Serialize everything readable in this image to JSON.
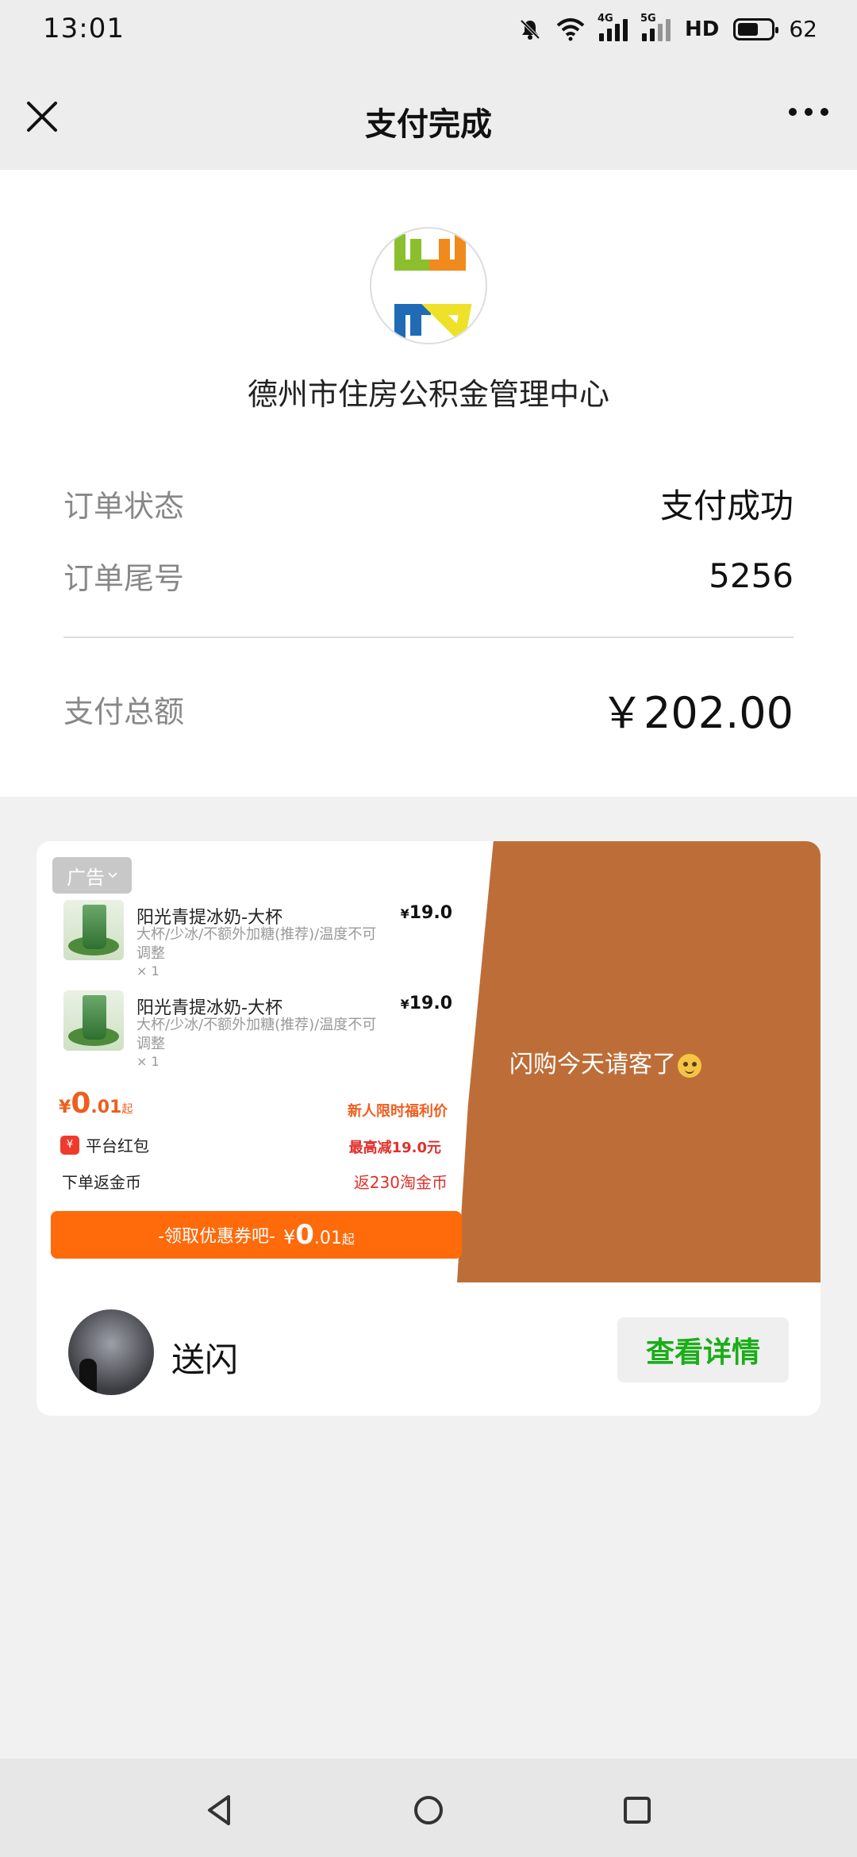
{
  "status_bar": {
    "time": "13:01",
    "network_4g": "4G",
    "network_5g": "5G",
    "hd": "HD",
    "battery": "62",
    "battery_level": 0.62
  },
  "nav": {
    "title": "支付完成"
  },
  "payment": {
    "merchant_name": "德州市住房公积金管理中心",
    "status_label": "订单状态",
    "status_value": "支付成功",
    "tail_label": "订单尾号",
    "tail_value": "5256",
    "total_label": "支付总额",
    "total_value": "￥202.00"
  },
  "ad": {
    "badge": "广告",
    "products": [
      {
        "name": "阳光青提冰奶-大杯",
        "price": "19.0",
        "currency": "¥",
        "desc": "大杯/少冰/不额外加糖(推荐)/温度不可调整",
        "qty": "× 1"
      },
      {
        "name": "阳光青提冰奶-大杯",
        "price": "19.0",
        "currency": "¥",
        "desc": "大杯/少冰/不额外加糖(推荐)/温度不可调整",
        "qty": "× 1"
      }
    ],
    "price_yen": "¥",
    "price_int": "0",
    "price_dec": ".01",
    "price_suffix": "起",
    "new_user_text": "新人限时福利价",
    "redpack_icon_text": "¥",
    "redpack_label": "平台红包",
    "redpack_discount": "最高减19.0元",
    "coins_label": "下单返金币",
    "coins_value": "返230淘金币",
    "cta_prefix": "-领取优惠券吧-",
    "cta_yen": "¥",
    "cta_int": "0",
    "cta_dec": ".01",
    "cta_suffix": "起",
    "slogan": "闪购今天请客了",
    "publisher_name": "送闪",
    "detail_button": "查看详情",
    "orange_color": "#bd6e38",
    "cta_color": "#ff6a0a"
  },
  "icons": {
    "close": "close-icon",
    "more": "more-icon",
    "back": "back-icon",
    "home": "home-icon",
    "recent": "recent-apps-icon"
  }
}
